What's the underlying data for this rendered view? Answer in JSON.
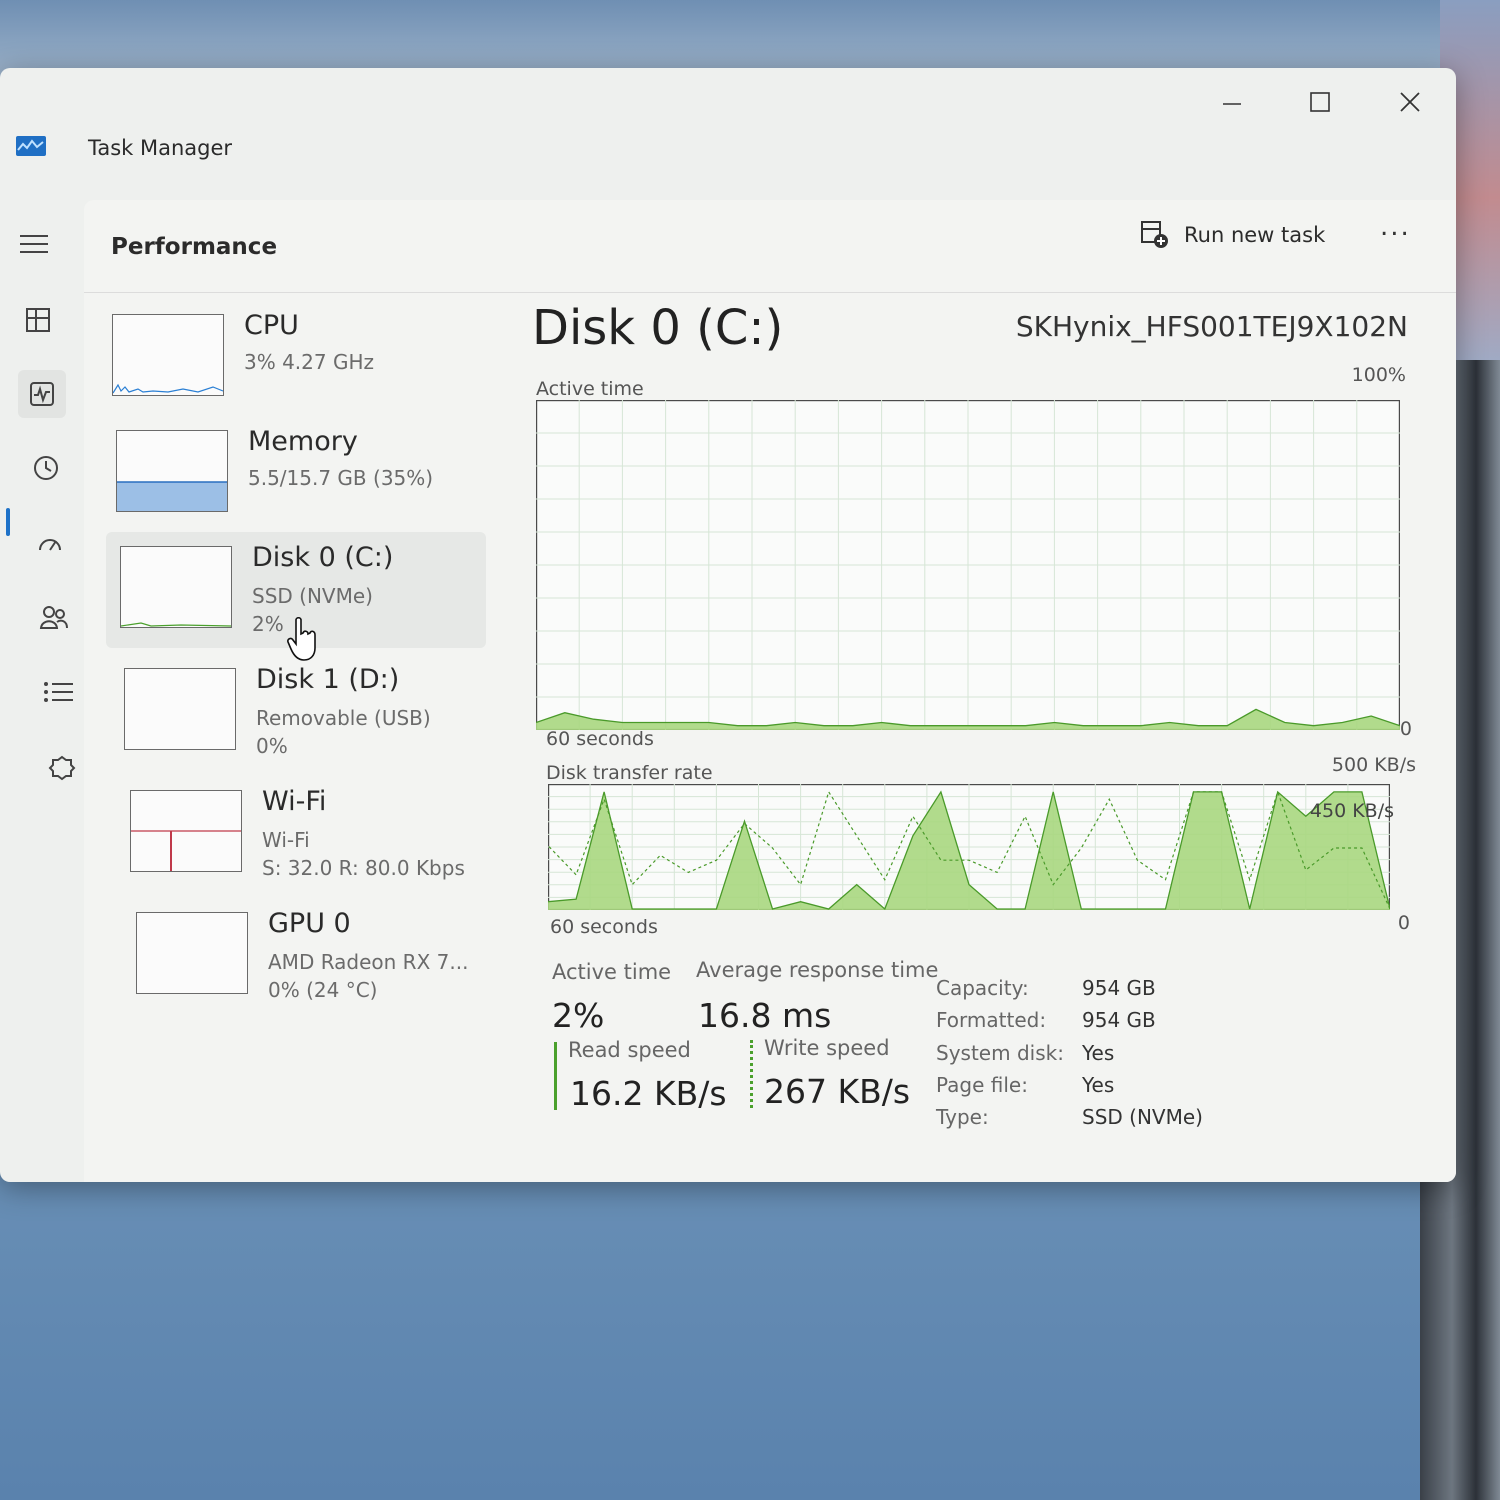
{
  "window": {
    "title": "Task Manager"
  },
  "header": {
    "page_title": "Performance",
    "run_task_label": "Run new task",
    "more_label": "..."
  },
  "devices": [
    {
      "name": "CPU",
      "line1": "3%  4.27 GHz",
      "line2": ""
    },
    {
      "name": "Memory",
      "line1": "5.5/15.7 GB (35%)",
      "line2": ""
    },
    {
      "name": "Disk 0 (C:)",
      "line1": "SSD (NVMe)",
      "line2": "2%"
    },
    {
      "name": "Disk 1 (D:)",
      "line1": "Removable (USB)",
      "line2": "0%"
    },
    {
      "name": "Wi-Fi",
      "line1": "Wi-Fi",
      "line2": "S: 32.0  R: 80.0 Kbps"
    },
    {
      "name": "GPU 0",
      "line1": "AMD Radeon RX 7...",
      "line2": "0%  (24 °C)"
    }
  ],
  "panel": {
    "title": "Disk 0 (C:)",
    "model": "SKHynix_HFS001TEJ9X102N",
    "active_time_label": "Active time",
    "active_max": "100%",
    "active_xlabel": "60 seconds",
    "active_zero": "0",
    "transfer_label": "Disk transfer rate",
    "transfer_max": "500 KB/s",
    "transfer_mid": "450 KB/s",
    "transfer_xlabel": "60 seconds",
    "transfer_zero": "0"
  },
  "stats": {
    "active_time_label": "Active time",
    "active_time_value": "2%",
    "avg_response_label": "Average response time",
    "avg_response_value": "16.8 ms",
    "read_label": "Read speed",
    "read_value": "16.2 KB/s",
    "write_label": "Write speed",
    "write_value": "267 KB/s"
  },
  "properties": [
    {
      "label": "Capacity:",
      "value": "954 GB"
    },
    {
      "label": "Formatted:",
      "value": "954 GB"
    },
    {
      "label": "System disk:",
      "value": "Yes"
    },
    {
      "label": "Page file:",
      "value": "Yes"
    },
    {
      "label": "Type:",
      "value": "SSD (NVMe)"
    }
  ],
  "chart_data": [
    {
      "type": "area",
      "title": "Active time",
      "xlabel": "60 seconds",
      "ylim": [
        0,
        100
      ],
      "x": [
        60,
        58,
        56,
        54,
        52,
        50,
        48,
        46,
        44,
        42,
        40,
        38,
        36,
        34,
        32,
        30,
        28,
        26,
        24,
        22,
        20,
        18,
        16,
        14,
        12,
        10,
        8,
        6,
        4,
        2,
        0
      ],
      "series": [
        {
          "values": [
            1,
            4,
            2,
            1,
            2,
            6,
            1,
            1,
            2,
            1,
            1,
            1,
            2,
            1,
            1,
            1,
            1,
            1,
            2,
            1,
            1,
            2,
            1,
            1,
            2,
            2,
            2,
            2,
            3,
            5,
            2
          ]
        }
      ]
    },
    {
      "type": "area",
      "title": "Disk transfer rate",
      "xlabel": "60 seconds",
      "ylim": [
        0,
        500
      ],
      "x": [
        60,
        58,
        56,
        54,
        52,
        50,
        48,
        46,
        44,
        42,
        40,
        38,
        36,
        34,
        32,
        30,
        28,
        26,
        24,
        22,
        20,
        18,
        16,
        14,
        12,
        10,
        8,
        6,
        4,
        2,
        0
      ],
      "series": [
        {
          "values": [
            0,
            480,
            480,
            380,
            480,
            0,
            480,
            480,
            0,
            0,
            0,
            0,
            480,
            0,
            0,
            100,
            480,
            300,
            0,
            100,
            0,
            30,
            0,
            360,
            0,
            0,
            0,
            0,
            480,
            40,
            30
          ]
        },
        {
          "values": [
            0,
            250,
            250,
            160,
            480,
            120,
            480,
            480,
            120,
            200,
            450,
            250,
            100,
            380,
            150,
            200,
            200,
            380,
            120,
            300,
            480,
            100,
            250,
            350,
            200,
            150,
            220,
            100,
            450,
            140,
            260
          ]
        }
      ]
    }
  ]
}
